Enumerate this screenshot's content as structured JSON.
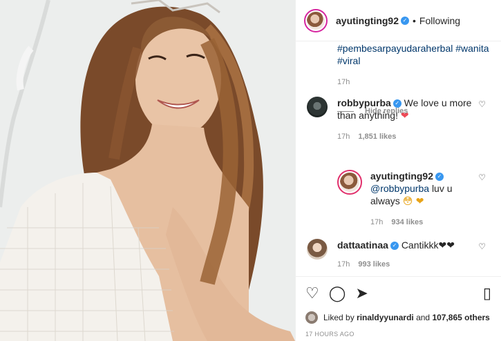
{
  "post": {
    "username": "ayutingting92",
    "follow_status": "Following",
    "caption_tags": [
      "#pembesarpayudaraherbal",
      "#wanita",
      "#viral"
    ],
    "caption_time": "17h"
  },
  "comments": [
    {
      "username": "robbypurba",
      "text": "We love u more than anything!",
      "emoji": "❤",
      "time": "17h",
      "likes": "1,851 likes"
    },
    {
      "username": "ayutingting92",
      "mention": "@robbypurba",
      "text": "luv u always",
      "emoji": "😳 ❤",
      "time": "17h",
      "likes": "934 likes"
    },
    {
      "username": "dattaatinaa",
      "text": "Cantikkk❤❤",
      "time": "17h",
      "likes": "993 likes"
    }
  ],
  "hide_replies": "Hide replies",
  "likes_summary": {
    "prefix": "Liked by",
    "user": "rinaldyyunardi",
    "and": "and",
    "others": "107,865 others"
  },
  "posted_ago": "17 HOURS AGO",
  "icons": [
    "heart-icon",
    "comment-icon",
    "share-icon",
    "bookmark-icon",
    "verified-icon"
  ]
}
